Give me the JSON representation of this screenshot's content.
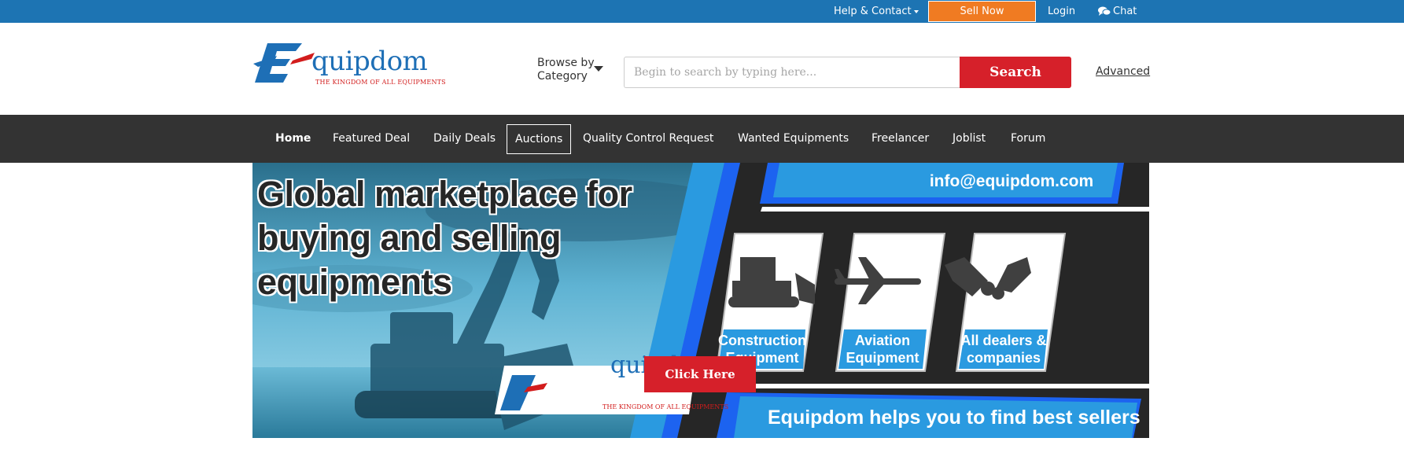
{
  "topbar": {
    "help_label": "Help & Contact",
    "sell_label": "Sell Now",
    "login_label": "Login",
    "chat_label": "Chat",
    "colors": {
      "bar": "#1d74b3",
      "sell": "#f07b22"
    }
  },
  "header": {
    "logo_text": "quipdom",
    "logo_tagline": "THE KINGDOM OF ALL EQUIPMENTS",
    "browse_line1": "Browse by",
    "browse_line2": "Category",
    "search_placeholder": "Begin to search by typing here...",
    "search_button": "Search",
    "advanced_label": "Advanced"
  },
  "nav": {
    "items": [
      {
        "label": "Home"
      },
      {
        "label": "Featured Deal"
      },
      {
        "label": "Daily Deals"
      },
      {
        "label": "Auctions"
      },
      {
        "label": "Quality Control Request"
      },
      {
        "label": "Wanted Equipments"
      },
      {
        "label": "Freelancer"
      },
      {
        "label": "Joblist"
      },
      {
        "label": "Forum"
      }
    ]
  },
  "banner": {
    "heading": "Global marketplace for buying and selling equipments",
    "email": "info@equipdom.com",
    "cards": [
      {
        "line1": "Construction",
        "line2": "Equipment",
        "icon": "bulldozer-icon"
      },
      {
        "line1": "Aviation",
        "line2": "Equipment",
        "icon": "airplane-icon"
      },
      {
        "line1": "All dealers &",
        "line2": "companies",
        "icon": "handshake-icon"
      }
    ],
    "click_here": "Click Here",
    "logo_text": "quipdom",
    "logo_tagline": "THE KINGDOM OF ALL EQUIPMENTS",
    "tagline": "Equipdom helps you to find best sellers"
  }
}
